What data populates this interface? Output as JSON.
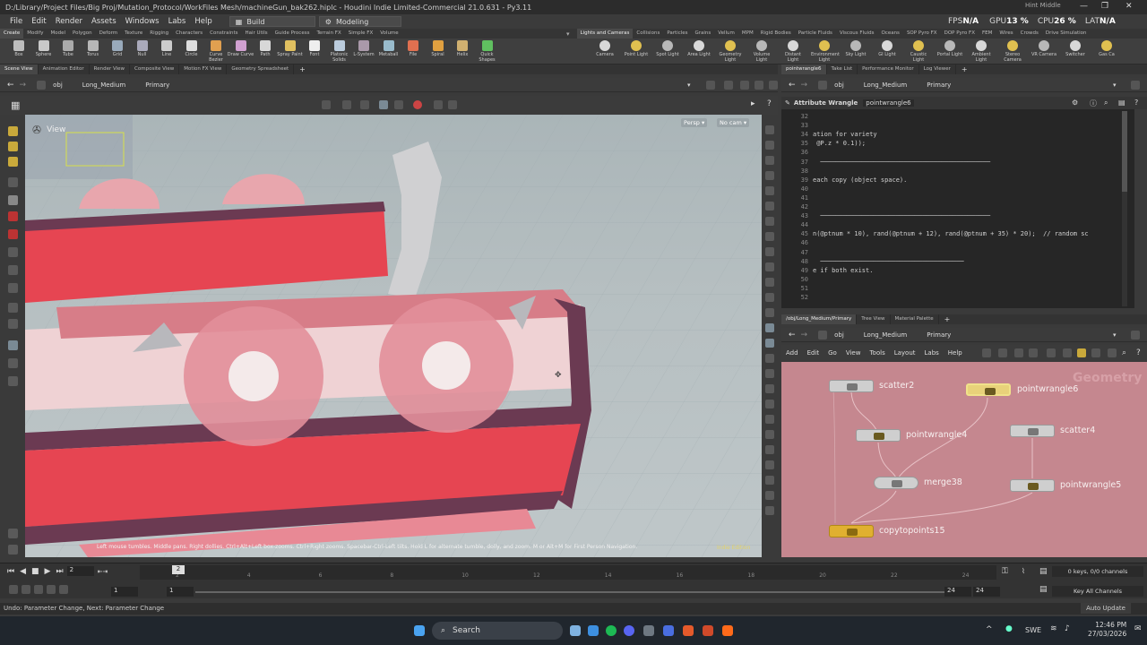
{
  "window": {
    "title": "D:/Library/Project Files/Big Proj/Mutation_Protocol/WorkFiles Mesh/machineGun_bak262.hiplc - Houdini Indie Limited-Commercial 21.0.631 - Py3.11",
    "hint": "Hint Middle",
    "controls": [
      "—",
      "❐",
      "✕"
    ]
  },
  "menu": {
    "items": [
      "File",
      "Edit",
      "Render",
      "Assets",
      "Windows",
      "Labs",
      "Help"
    ],
    "desktop": "Build",
    "desktop2": "Modeling",
    "perf": {
      "fps_label": "FPS",
      "fps": "N/A",
      "gpu_label": "GPU",
      "gpu": "13 %",
      "cpu_label": "CPU",
      "cpu": "26 %",
      "lat_label": "LAT",
      "lat": "N/A"
    }
  },
  "shelf": {
    "tabs_left": [
      "Create",
      "Modify",
      "Model",
      "Polygon",
      "Deform",
      "Texture",
      "Rigging",
      "Characters",
      "Constraints",
      "Hair Utils",
      "Guide Process",
      "Terrain FX",
      "Simple FX",
      "Volume"
    ],
    "tabs_right": [
      "Lights and Cameras",
      "Collisions",
      "Particles",
      "Grains",
      "Vellum",
      "MPM",
      "Rigid Bodies",
      "Particle Fluids",
      "Viscous Fluids",
      "Oceans",
      "SOP Pyro FX",
      "DOP Pyro FX",
      "FEM",
      "Wires",
      "Crowds",
      "Drive Simulation"
    ],
    "tools_left": [
      "Box",
      "Sphere",
      "Tube",
      "Torus",
      "Grid",
      "Null",
      "Line",
      "Circle",
      "Curve Bezier",
      "Draw Curve",
      "Path",
      "Spray Paint",
      "Font",
      "Platonic Solids",
      "L-System",
      "Metaball",
      "File",
      "Spiral",
      "Helix",
      "Quick Shapes"
    ],
    "tools_right": [
      "Camera",
      "Point Light",
      "Spot Light",
      "Area Light",
      "Geometry Light",
      "Volume Light",
      "Distant Light",
      "Environment Light",
      "Sky Light",
      "GI Light",
      "Caustic Light",
      "Portal Light",
      "Ambient Light",
      "Stereo Camera",
      "VR Camera",
      "Switcher",
      "Gas Ca"
    ]
  },
  "left_pane": {
    "tabs": [
      "Scene View",
      "Animation Editor",
      "Render View",
      "Composite View",
      "Motion FX View",
      "Geometry Spreadsheet"
    ],
    "path": {
      "root": "obj",
      "net": "Long_Medium",
      "node": "Primary"
    },
    "viewport": {
      "label": "View",
      "persp": "Persp ▾",
      "cam": "No cam ▾",
      "help_text": "Left mouse tumbles. Middle pans. Right dollies. Ctrl+Alt+Left box-zooms. Ctrl+Right zooms. Spacebar-Ctrl-Left tilts. Hold L for alternate tumble, dolly, and zoom. M or Alt+M for First Person Navigation.",
      "corner_text": "Indie Edition"
    }
  },
  "right_top": {
    "tabs": [
      "pointwrangle6",
      "Take List",
      "Performance Monitor",
      "Log Viewer"
    ],
    "path": {
      "root": "obj",
      "net": "Long_Medium",
      "node": "Primary"
    },
    "param_type": "Attribute Wrangle",
    "param_name": "pointwrangle6",
    "code": [
      {
        "n": "32",
        "t": ""
      },
      {
        "n": "33",
        "t": ""
      },
      {
        "n": "34",
        "t": "ation for variety"
      },
      {
        "n": "35",
        "t": " @P.z * 0.1));"
      },
      {
        "n": "36",
        "t": ""
      },
      {
        "n": "37",
        "t": "  ─────────────────────────────────────────────"
      },
      {
        "n": "38",
        "t": ""
      },
      {
        "n": "39",
        "t": "each copy (object space)."
      },
      {
        "n": "40",
        "t": ""
      },
      {
        "n": "41",
        "t": ""
      },
      {
        "n": "42",
        "t": ""
      },
      {
        "n": "43",
        "t": "  ─────────────────────────────────────────────"
      },
      {
        "n": "44",
        "t": ""
      },
      {
        "n": "45",
        "t": "n(@ptnum * 10), rand(@ptnum + 12), rand(@ptnum + 35) * 20);  // random sc"
      },
      {
        "n": "46",
        "t": ""
      },
      {
        "n": "47",
        "t": ""
      },
      {
        "n": "48",
        "t": "  ──────────────────────────────────────"
      },
      {
        "n": "49",
        "t": "e if both exist."
      },
      {
        "n": "50",
        "t": ""
      },
      {
        "n": "51",
        "t": ""
      },
      {
        "n": "52",
        "t": ""
      }
    ]
  },
  "right_bottom": {
    "tabs": [
      "/obj/Long_Medium/Primary",
      "Tree View",
      "Material Palette"
    ],
    "path": {
      "root": "obj",
      "net": "Long_Medium",
      "node": "Primary"
    },
    "menu": [
      "Add",
      "Edit",
      "Go",
      "View",
      "Tools",
      "Layout",
      "Labs",
      "Help"
    ],
    "watermark": "Geometry",
    "nodes": [
      "scatter2",
      "pointwrangle6",
      "pointwrangle4",
      "scatter4",
      "merge38",
      "pointwrangle5",
      "copytopoints15"
    ]
  },
  "timeline": {
    "current_frame": "2",
    "start": "1",
    "start2": "1",
    "end": "24",
    "end2": "24",
    "ticks": [
      "2",
      "4",
      "6",
      "8",
      "10",
      "12",
      "14",
      "16",
      "18",
      "20",
      "22",
      "24"
    ],
    "keys_info": "0 keys, 0/0 channels",
    "channels": "Key All Channels",
    "auto_update": "Auto Update"
  },
  "status": "Undo: Parameter Change, Next: Parameter Change",
  "taskbar": {
    "search": "Search",
    "lang": "SWE",
    "time": "12:46 PM",
    "date": "27/03/2026"
  },
  "colors": {
    "node_bg": "#c5878f",
    "accent_red": "#e23a45",
    "mesh_purple": "#6b3a52"
  }
}
